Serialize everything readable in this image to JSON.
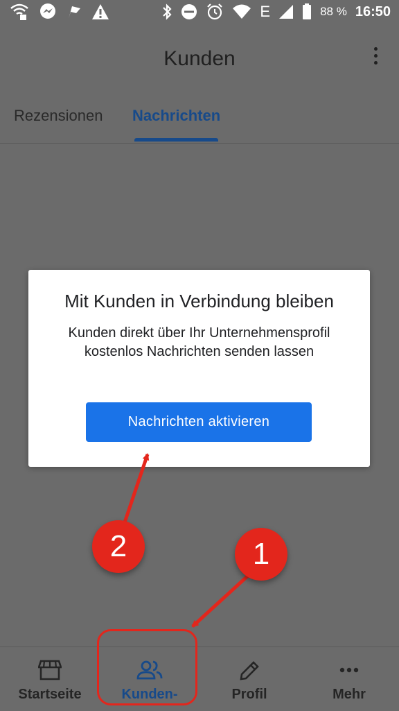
{
  "status_bar": {
    "battery": "88 %",
    "time": "16:50",
    "network": "E",
    "icons_left": [
      "wifi-lock-icon",
      "messenger-icon",
      "flag-icon",
      "warning-icon"
    ],
    "icons_right": [
      "bluetooth-icon",
      "dnd-icon",
      "alarm-icon",
      "wifi-icon",
      "signal-icon",
      "battery-icon"
    ]
  },
  "app_bar": {
    "title": "Kunden"
  },
  "tabs": [
    {
      "label": "Rezensionen",
      "active": false
    },
    {
      "label": "Nachrichten",
      "active": true
    }
  ],
  "dialog": {
    "title": "Mit Kunden in Verbindung bleiben",
    "body": "Kunden direkt über Ihr Unternehmensprofil kostenlos Nachrichten senden lassen",
    "button": "Nachrichten aktivieren"
  },
  "bottom_nav": [
    {
      "label": "Startseite",
      "icon": "store-icon",
      "active": false
    },
    {
      "label": "Kunden-",
      "icon": "people-icon",
      "active": true
    },
    {
      "label": "Profil",
      "icon": "pencil-icon",
      "active": false
    },
    {
      "label": "Mehr",
      "icon": "more-horizontal-icon",
      "active": false
    }
  ],
  "annotations": {
    "step1": "1",
    "step2": "2"
  },
  "colors": {
    "accent": "#1a73e8",
    "active_tab": "#174a8a",
    "scrim_background": "#6b6b6b",
    "annotation_red": "#e3261c"
  }
}
